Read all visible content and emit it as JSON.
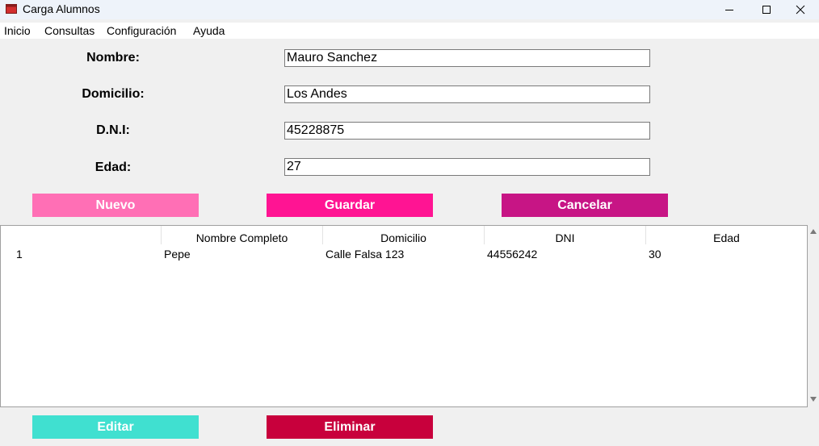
{
  "window": {
    "title": "Carga Alumnos",
    "icon": "app-window-icon",
    "controls": [
      "minimize-icon",
      "maximize-icon",
      "close-icon"
    ]
  },
  "menu": {
    "items": [
      "Inicio",
      "Consultas",
      "Configuración",
      "Ayuda"
    ]
  },
  "form": {
    "nombre_label": "Nombre:",
    "nombre_value": "Mauro Sanchez",
    "domicilio_label": "Domicilio:",
    "domicilio_value": "Los Andes",
    "dni_label": "D.N.I:",
    "dni_value": "45228875",
    "edad_label": "Edad:",
    "edad_value": "27"
  },
  "buttons": {
    "nuevo": "Nuevo",
    "guardar": "Guardar",
    "cancelar": "Cancelar",
    "editar": "Editar",
    "eliminar": "Eliminar"
  },
  "colors": {
    "nuevo": "#ff6fb5",
    "guardar": "#ff1493",
    "cancelar": "#c71585",
    "editar": "#40e0d0",
    "eliminar": "#c8003c"
  },
  "table": {
    "columns": [
      "",
      "Nombre Completo",
      "Domicilio",
      "DNI",
      "Edad"
    ],
    "rows": [
      {
        "id": "1",
        "nombre": "Pepe",
        "domicilio": "Calle Falsa 123",
        "dni": "44556242",
        "edad": "30"
      }
    ]
  }
}
